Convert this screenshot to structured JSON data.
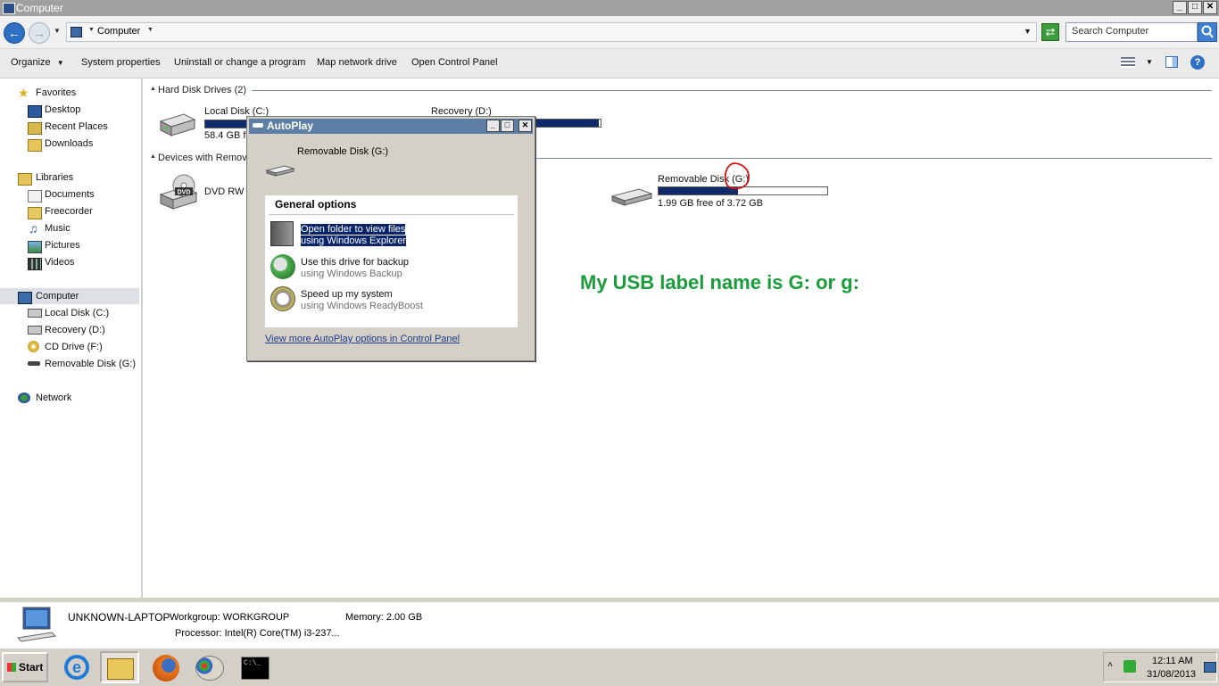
{
  "window": {
    "title": "Computer"
  },
  "address": {
    "path": "Computer",
    "search_placeholder": "Search Computer"
  },
  "toolbar": {
    "organize": "Organize",
    "system_properties": "System properties",
    "uninstall": "Uninstall or change a program",
    "map_drive": "Map network drive",
    "open_control_panel": "Open Control Panel"
  },
  "sidebar": {
    "favorites": "Favorites",
    "favorites_items": [
      "Desktop",
      "Recent Places",
      "Downloads"
    ],
    "libraries": "Libraries",
    "libraries_items": [
      "Documents",
      "Freecorder",
      "Music",
      "Pictures",
      "Videos"
    ],
    "computer": "Computer",
    "computer_items": [
      "Local Disk (C:)",
      "Recovery (D:)",
      "CD Drive (F:)",
      "Removable Disk (G:)"
    ],
    "network": "Network"
  },
  "content": {
    "hard_disk_group": "Hard Disk Drives (2)",
    "removable_group": "Devices with Removable Storage",
    "local_disk": {
      "name": "Local Disk (C:)",
      "free": "58.4 GB free"
    },
    "recovery": {
      "name": "Recovery (D:)",
      "used_fraction": 0.98
    },
    "dvd": {
      "name": "DVD RW Drive"
    },
    "removable": {
      "name": "Removable Disk (G:)",
      "free": "1.99 GB free of 3.72 GB",
      "used_fraction": 0.47
    }
  },
  "annotation": "My USB label name is G: or g:",
  "details": {
    "computer_name": "UNKNOWN-LAPTOP",
    "workgroup": "Workgroup: WORKGROUP",
    "memory": "Memory: 2.00 GB",
    "processor": "Processor: Intel(R) Core(TM) i3-237..."
  },
  "autoplay": {
    "title": "AutoPlay",
    "device": "Removable Disk (G:)",
    "general_options": "General options",
    "options": [
      {
        "main": "Open folder to view files",
        "sub": "using Windows Explorer"
      },
      {
        "main": "Use this drive for backup",
        "sub": "using Windows Backup"
      },
      {
        "main": "Speed up my system",
        "sub": "using Windows ReadyBoost"
      }
    ],
    "more_link": "View more AutoPlay options in Control Panel"
  },
  "taskbar": {
    "start": "Start",
    "time": "12:11 AM",
    "date": "31/08/2013"
  },
  "colors": {
    "bar_fill": "#0f2a6b",
    "annotation": "#1a9c3c",
    "annotation_circle": "#d01010"
  }
}
